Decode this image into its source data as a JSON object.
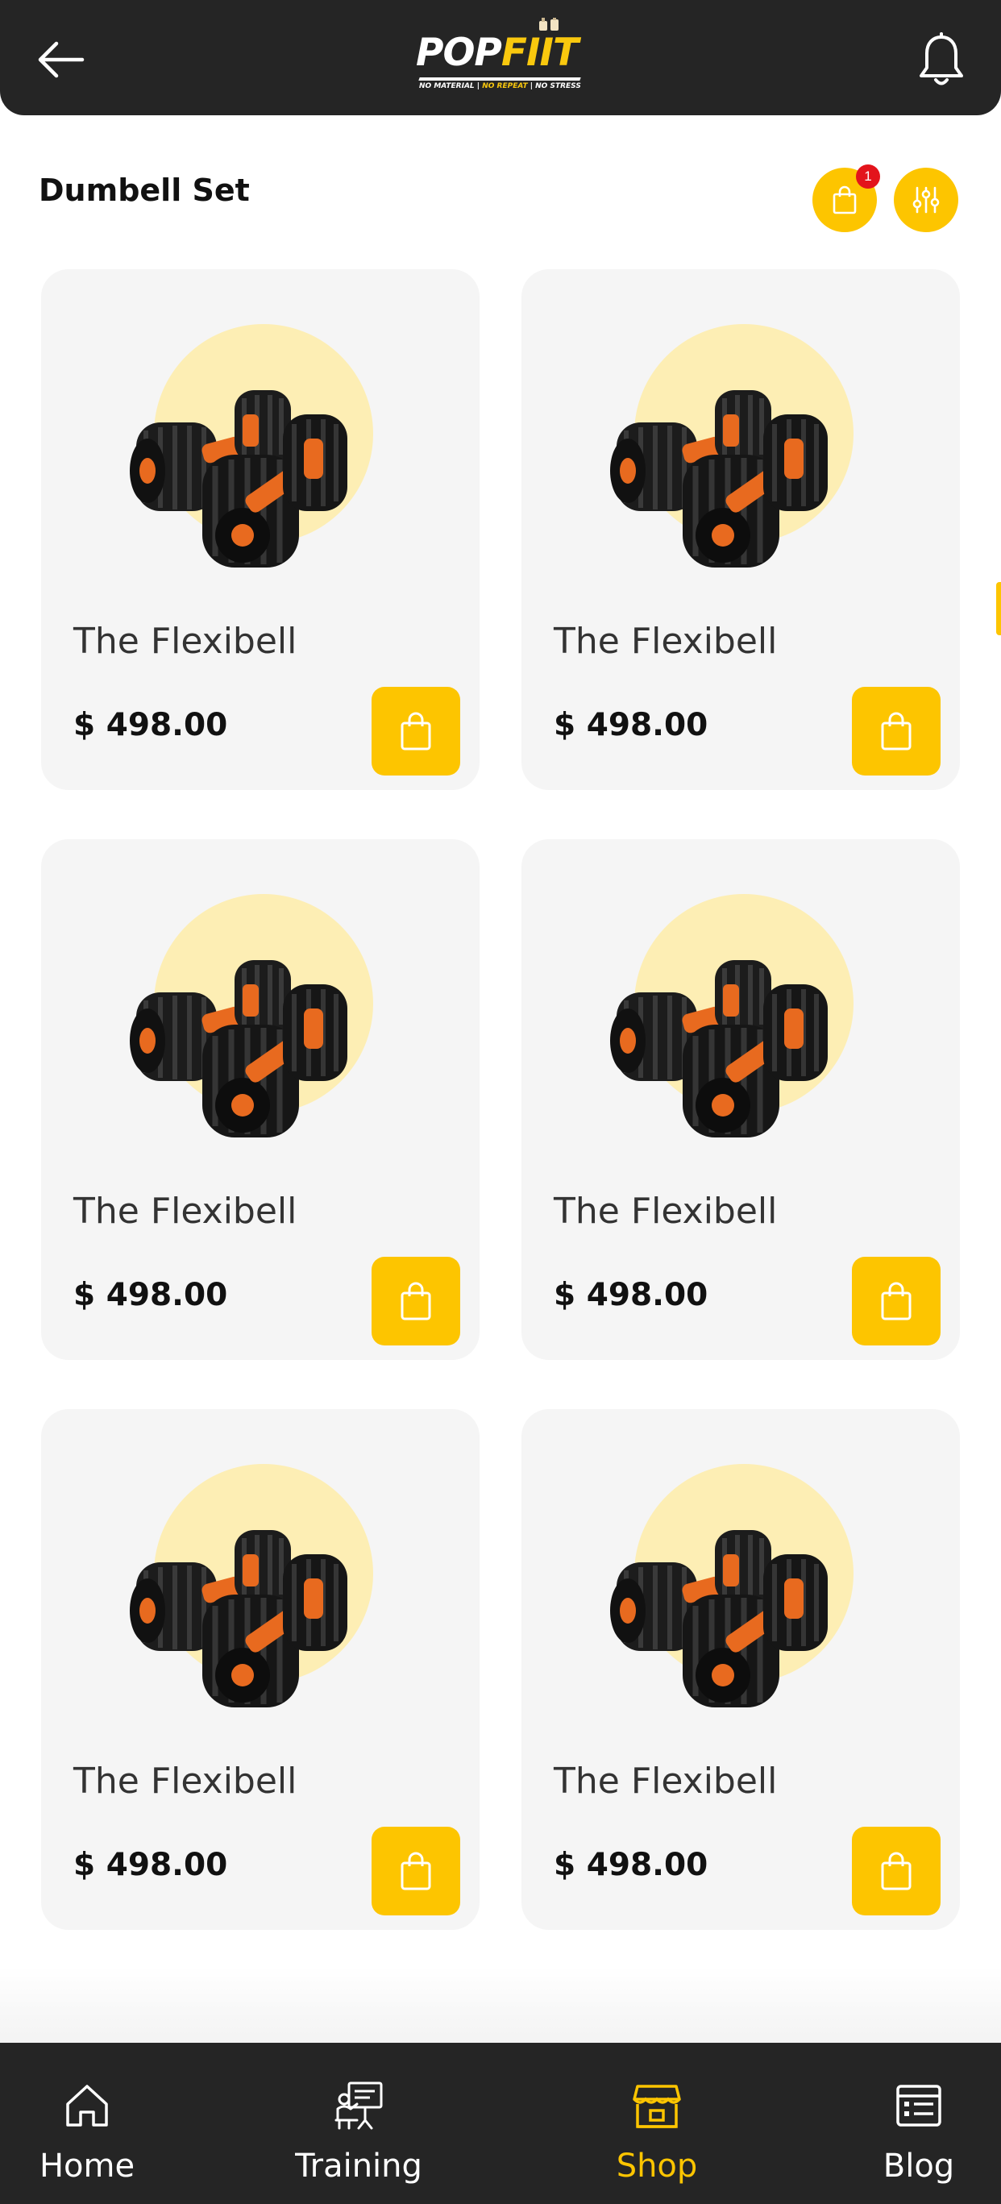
{
  "header": {
    "logo": {
      "word_left": "POP",
      "word_right": "FIIT",
      "tag_1": "NO MATERIAL |",
      "tag_2": " NO REPEAT ",
      "tag_3": "| NO STRESS"
    },
    "back_icon": "arrow-left-icon",
    "notification_icon": "bell-icon"
  },
  "page": {
    "title": "Dumbell Set",
    "cart_badge": "1",
    "cart_icon": "shopping-bag-icon",
    "filter_icon": "sliders-icon"
  },
  "products": [
    {
      "name": "The Flexibell",
      "price": "$ 498.00"
    },
    {
      "name": "The Flexibell",
      "price": "$ 498.00"
    },
    {
      "name": "The Flexibell",
      "price": "$ 498.00"
    },
    {
      "name": "The Flexibell",
      "price": "$ 498.00"
    },
    {
      "name": "The Flexibell",
      "price": "$ 498.00"
    },
    {
      "name": "The Flexibell",
      "price": "$ 498.00"
    }
  ],
  "nav": {
    "items": [
      {
        "label": "Home",
        "icon": "home-icon"
      },
      {
        "label": "Training",
        "icon": "presentation-icon"
      },
      {
        "label": "Shop",
        "icon": "store-icon",
        "active": true
      },
      {
        "label": "Blog",
        "icon": "newspaper-icon"
      }
    ]
  },
  "colors": {
    "accent": "#fdc500",
    "dark": "#252525",
    "card": "#f5f5f5",
    "badge": "#e3141b"
  }
}
